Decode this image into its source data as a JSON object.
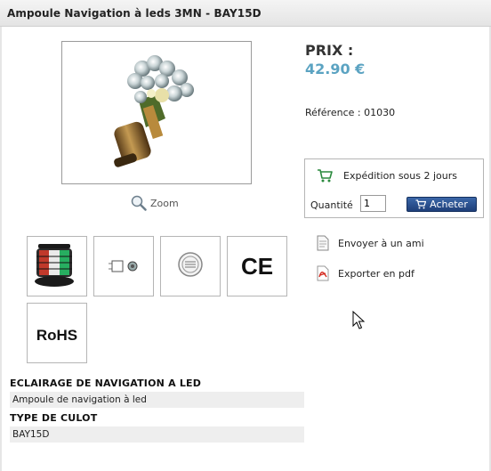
{
  "product": {
    "title": "Ampoule Navigation à leds 3MN - BAY15D",
    "zoom_label": "Zoom",
    "price_label": "PRIX :",
    "price": "42.90 €",
    "reference": "Référence : 01030"
  },
  "order": {
    "shipping": "Expédition sous 2 jours",
    "quantity_label": "Quantité",
    "quantity_value": "1",
    "buy_label": "Acheter"
  },
  "actions": {
    "email_friend": "Envoyer à un ami",
    "export_pdf": "Exporter en pdf"
  },
  "thumbnails": [
    {
      "icon": "navigation-light-icon"
    },
    {
      "icon": "connector-icon"
    },
    {
      "icon": "seal-icon"
    },
    {
      "icon": "ce-mark-icon",
      "text": "CE"
    },
    {
      "icon": "rohs-icon",
      "text": "RoHS"
    }
  ],
  "specs": [
    {
      "heading": "ECLAIRAGE DE NAVIGATION A LED",
      "value": "Ampoule de navigation à led"
    },
    {
      "heading": "TYPE DE CULOT",
      "value": "BAY15D"
    }
  ],
  "colors": {
    "price": "#5ba3c2",
    "buy_button": "#2a4f8f"
  }
}
